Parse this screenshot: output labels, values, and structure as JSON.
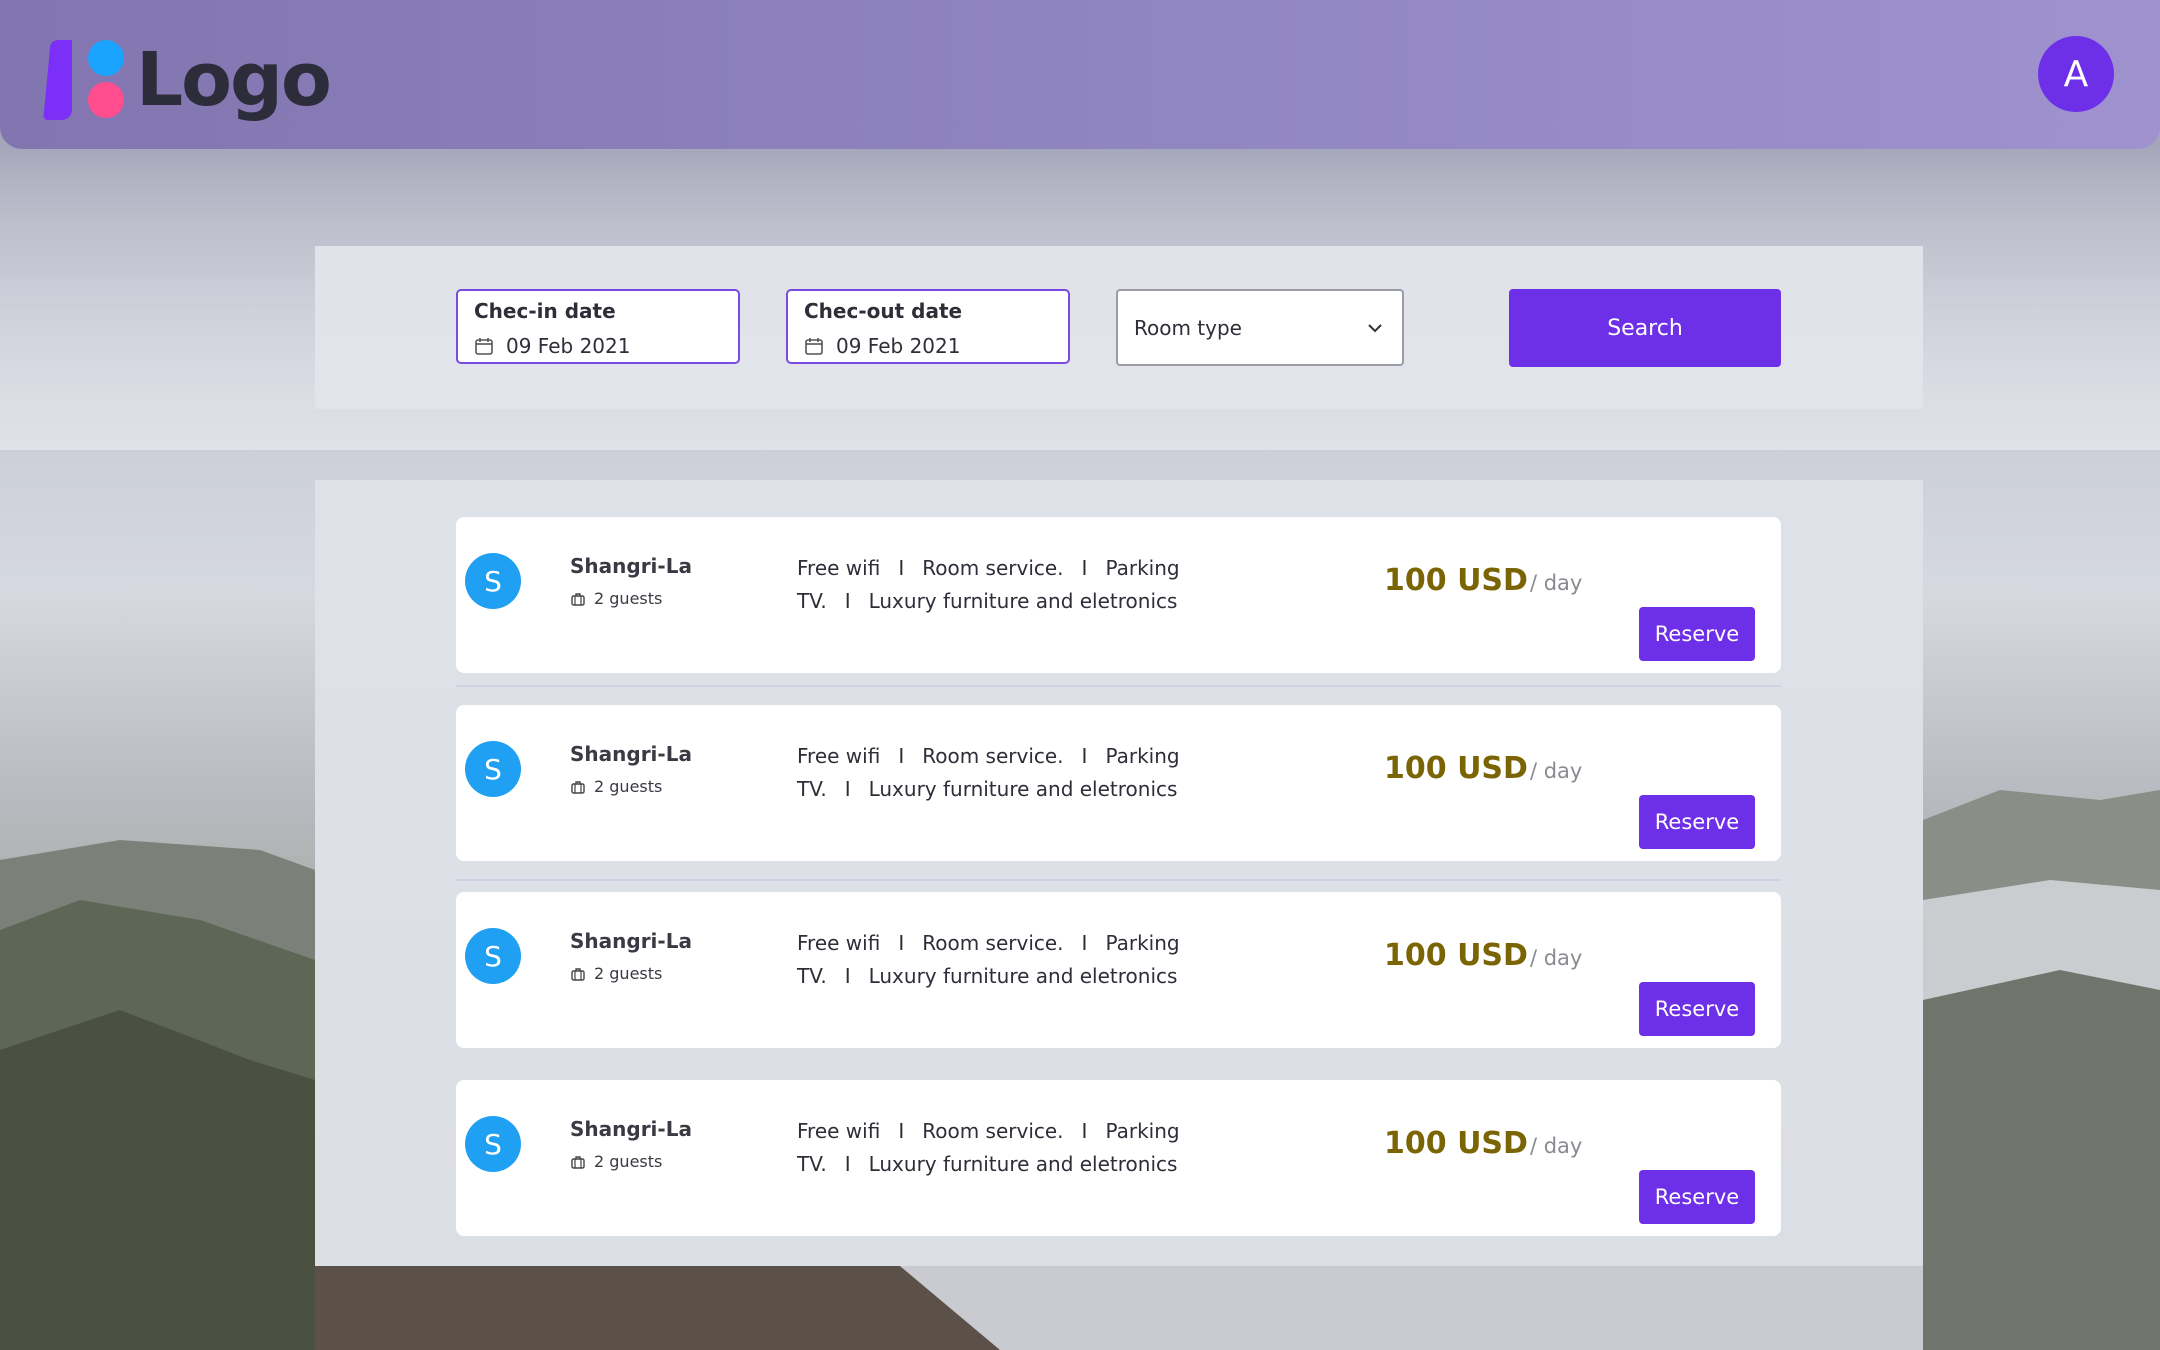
{
  "header": {
    "logo_text": "Logo",
    "user_avatar_initial": "A"
  },
  "search": {
    "checkin": {
      "label": "Chec-in date",
      "value": "09 Feb 2021"
    },
    "checkout": {
      "label": "Chec-out date",
      "value": "09 Feb 2021"
    },
    "room_type": {
      "value": "Room type"
    },
    "search_button": "Search"
  },
  "results": [
    {
      "initial": "S",
      "name": "Shangri-La",
      "guests": "2 guests",
      "amenities_row1": [
        "Free wifi",
        "Room service.",
        "Parking"
      ],
      "amenities_row2": [
        "TV.",
        "Luxury furniture and eletronics"
      ],
      "separator": "I",
      "price": "100 USD",
      "price_unit": "/ day",
      "reserve": "Reserve"
    },
    {
      "initial": "S",
      "name": "Shangri-La",
      "guests": "2 guests",
      "amenities_row1": [
        "Free wifi",
        "Room service.",
        "Parking"
      ],
      "amenities_row2": [
        "TV.",
        "Luxury furniture and eletronics"
      ],
      "separator": "I",
      "price": "100 USD",
      "price_unit": "/ day",
      "reserve": "Reserve"
    },
    {
      "initial": "S",
      "name": "Shangri-La",
      "guests": "2 guests",
      "amenities_row1": [
        "Free wifi",
        "Room service.",
        "Parking"
      ],
      "amenities_row2": [
        "TV.",
        "Luxury furniture and eletronics"
      ],
      "separator": "I",
      "price": "100 USD",
      "price_unit": "/ day",
      "reserve": "Reserve"
    },
    {
      "initial": "S",
      "name": "Shangri-La",
      "guests": "2 guests",
      "amenities_row1": [
        "Free wifi",
        "Room service.",
        "Parking"
      ],
      "amenities_row2": [
        "TV.",
        "Luxury furniture and eletronics"
      ],
      "separator": "I",
      "price": "100 USD",
      "price_unit": "/ day",
      "reserve": "Reserve"
    }
  ],
  "colors": {
    "accent": "#6d2fe8",
    "price": "#7a6404",
    "avatar_blue": "#1fa0f2",
    "logo_blue": "#1aa3ff",
    "logo_pink": "#ff4d8d",
    "logo_purple": "#7b2ff7"
  },
  "icons": [
    "calendar-icon",
    "chevron-down-icon",
    "luggage-icon"
  ]
}
